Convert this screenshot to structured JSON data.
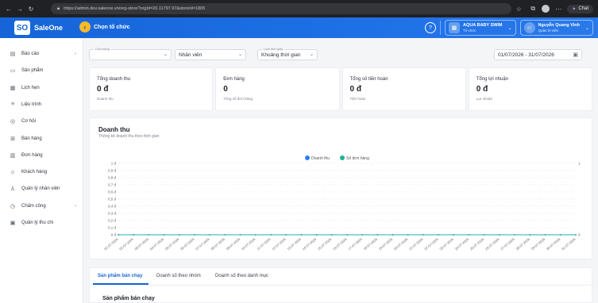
{
  "browser": {
    "url": "https://admin.dev.saleone.vn/org-store?orgId=20.11797.97&storeId=1805",
    "chat_label": "Chat"
  },
  "header": {
    "logo_mark": "SO",
    "app_name": "SaleOne",
    "org_selector": "Chọn tổ chức",
    "store_name": "AQUA BABY SWIM",
    "store_role": "Tổ chức",
    "user_name": "Nguyễn Quang Vinh",
    "user_role": "Quản trị viên"
  },
  "sidebar": {
    "items": [
      {
        "label": "Báo cáo",
        "icon": "doc-icon",
        "has_children": true
      },
      {
        "label": "Sản phẩm",
        "icon": "monitor-icon",
        "has_children": false
      },
      {
        "label": "Lịch hẹn",
        "icon": "calendar-icon",
        "has_children": false
      },
      {
        "label": "Liệu trình",
        "icon": "list-icon",
        "has_children": false
      },
      {
        "label": "Cơ hội",
        "icon": "target-icon",
        "has_children": false
      },
      {
        "label": "Bán hàng",
        "icon": "cart-icon",
        "has_children": false
      },
      {
        "label": "Đơn hàng",
        "icon": "receipt-icon",
        "has_children": false
      },
      {
        "label": "Khách hàng",
        "icon": "users-icon",
        "has_children": false
      },
      {
        "label": "Quản lý nhân viên",
        "icon": "staff-icon",
        "has_children": false
      },
      {
        "label": "Chấm công",
        "icon": "clock-icon",
        "has_children": true
      },
      {
        "label": "Quản lý thu chi",
        "icon": "wallet-icon",
        "has_children": false
      }
    ]
  },
  "filters": {
    "store_label": "Cửa hàng",
    "store_value": "",
    "staff_value": "Nhân viên",
    "time_label": "Loại thời gian",
    "time_value": "Khoảng thời gian",
    "date_range": "01/07/2026 - 31/07/2026"
  },
  "cards": [
    {
      "title": "Tổng doanh thu",
      "value": "0 đ",
      "sub": "Doanh thu"
    },
    {
      "title": "Đơn hàng",
      "value": "0",
      "sub": "Tổng số đơn hàng"
    },
    {
      "title": "Tổng số tiền hoàn",
      "value": "0 đ",
      "sub": "Tiền hoàn"
    },
    {
      "title": "Tổng lợi nhuận",
      "value": "0 đ",
      "sub": "Lợi nhuận"
    }
  ],
  "chart": {
    "title": "Doanh thu",
    "subtitle": "Thống kê doanh thu theo thời gian",
    "colors": {
      "revenue": "#2f7cf6",
      "orders": "#19b394"
    }
  },
  "chart_data": {
    "type": "line",
    "title": "Doanh thu",
    "x": [
      "01-07-2026",
      "02-07-2026",
      "03-07-2026",
      "04-07-2026",
      "05-07-2026",
      "06-07-2026",
      "07-07-2026",
      "08-07-2026",
      "09-07-2026",
      "10-07-2026",
      "11-07-2026",
      "12-07-2026",
      "13-07-2026",
      "14-07-2026",
      "15-07-2026",
      "16-07-2026",
      "17-07-2026",
      "18-07-2026",
      "19-07-2026",
      "20-07-2026",
      "21-07-2026",
      "22-07-2026",
      "23-07-2026",
      "24-07-2026",
      "25-07-2026",
      "26-07-2026",
      "27-07-2026",
      "28-07-2026",
      "29-07-2026",
      "30-07-2026",
      "31-07-2026"
    ],
    "series": [
      {
        "name": "Doanh thu",
        "values": [
          0,
          0,
          0,
          0,
          0,
          0,
          0,
          0,
          0,
          0,
          0,
          0,
          0,
          0,
          0,
          0,
          0,
          0,
          0,
          0,
          0,
          0,
          0,
          0,
          0,
          0,
          0,
          0,
          0,
          0,
          0
        ]
      },
      {
        "name": "Số đơn hàng",
        "values": [
          0,
          0,
          0,
          0,
          0,
          0,
          0,
          0,
          0,
          0,
          0,
          0,
          0,
          0,
          0,
          0,
          0,
          0,
          0,
          0,
          0,
          0,
          0,
          0,
          0,
          0,
          0,
          0,
          0,
          0,
          0
        ]
      }
    ],
    "y_ticks": [
      "0 đ",
      "0,1 đ",
      "0,2 đ",
      "0,3 đ",
      "0,4 đ",
      "0,5 đ",
      "0,6 đ",
      "0,7 đ",
      "0,8 đ",
      "0,9 đ",
      "1 đ"
    ],
    "y2_ticks": [
      "0",
      "1"
    ],
    "ylim": [
      0,
      1
    ],
    "grid": true,
    "legend": "top-center"
  },
  "tabs": {
    "items": [
      "Sản phẩm bán chạy",
      "Doanh số theo nhóm",
      "Doanh số theo danh mục"
    ],
    "section_title": "Sản phẩm bán chạy"
  }
}
